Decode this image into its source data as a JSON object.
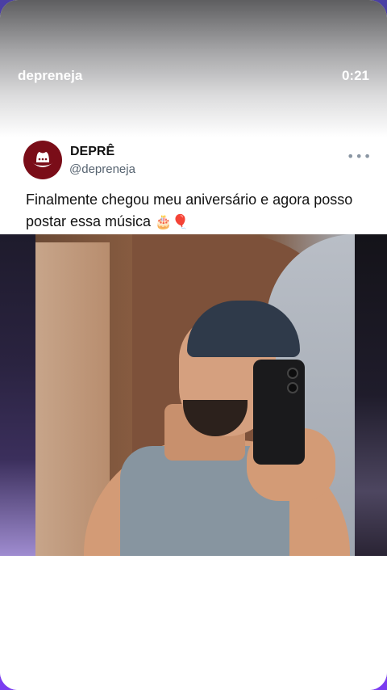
{
  "story": {
    "account": "depreneja",
    "time": "0:21"
  },
  "tweet": {
    "display_name": "DEPRÊ",
    "handle": "@depreneja",
    "more_label": "•••",
    "text": "Finalmente chegou meu aniversário e agora posso postar essa música",
    "emojis": "🎂🎈"
  },
  "colors": {
    "avatar_bg": "#7a0d18",
    "handle_text": "#566370"
  },
  "icons": {
    "avatar": "cowboy-hat-logo-icon",
    "more": "more-options-icon"
  }
}
